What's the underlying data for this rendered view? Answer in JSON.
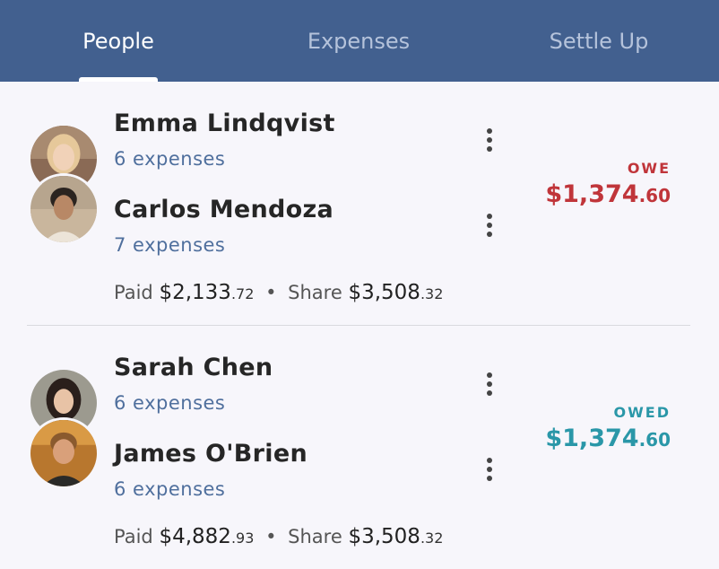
{
  "tabs": [
    {
      "label": "People",
      "active": true
    },
    {
      "label": "Expenses",
      "active": false
    },
    {
      "label": "Settle Up",
      "active": false
    }
  ],
  "groups": [
    {
      "members": [
        {
          "name": "Emma Lindqvist",
          "expenses": "6 expenses",
          "avatar": "avatar-emma"
        },
        {
          "name": "Carlos Mendoza",
          "expenses": "7 expenses",
          "avatar": "avatar-carlos"
        }
      ],
      "summary": {
        "paid_label": "Paid",
        "paid_dollars": "$2,133",
        "paid_cents": ".72",
        "separator": "•",
        "share_label": "Share",
        "share_dollars": "$3,508",
        "share_cents": ".32"
      },
      "status": "OWE",
      "balance_dollars": "$1,374",
      "balance_cents": ".60",
      "status_color": "#c0353a"
    },
    {
      "members": [
        {
          "name": "Sarah Chen",
          "expenses": "6 expenses",
          "avatar": "avatar-sarah"
        },
        {
          "name": "James O'Brien",
          "expenses": "6 expenses",
          "avatar": "avatar-james"
        }
      ],
      "summary": {
        "paid_label": "Paid",
        "paid_dollars": "$4,882",
        "paid_cents": ".93",
        "separator": "•",
        "share_label": "Share",
        "share_dollars": "$3,508",
        "share_cents": ".32"
      },
      "status": "OWED",
      "balance_dollars": "$1,374",
      "balance_cents": ".60",
      "status_color": "#2a97a8"
    }
  ],
  "colors": {
    "header": "#42608f",
    "tab_inactive": "#b5c3db",
    "link_blue": "#4f6f9d",
    "owe_red": "#c0353a",
    "owed_teal": "#2a97a8"
  }
}
